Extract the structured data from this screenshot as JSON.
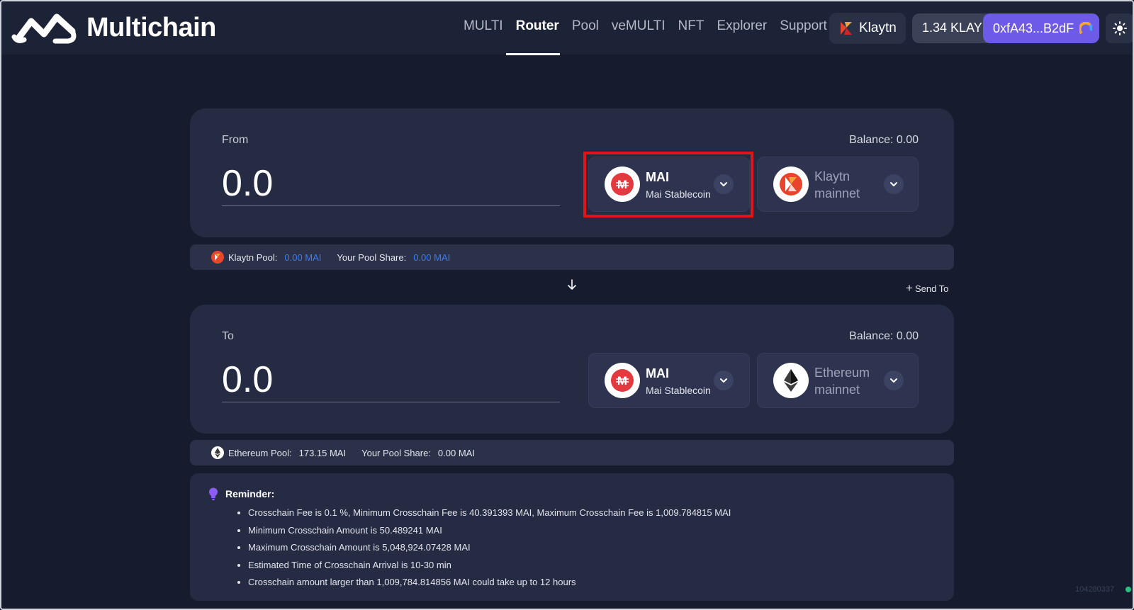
{
  "header": {
    "brand": "Multichain",
    "nav": [
      {
        "label": "MULTI",
        "active": false
      },
      {
        "label": "Router",
        "active": true
      },
      {
        "label": "Pool",
        "active": false
      },
      {
        "label": "veMULTI",
        "active": false
      },
      {
        "label": "NFT",
        "active": false
      },
      {
        "label": "Explorer",
        "active": false
      },
      {
        "label": "Support",
        "active": false
      }
    ],
    "chain_button": "Klaytn",
    "wallet_balance": "1.34 KLAY",
    "wallet_address": "0xfA43...B2dF"
  },
  "from": {
    "label": "From",
    "balance": "Balance: 0.00",
    "amount": "0.0",
    "token_symbol": "MAI",
    "token_name": "Mai Stablecoin",
    "chain_line1": "Klaytn",
    "chain_line2": "mainnet"
  },
  "from_pool": {
    "pool_label": "Klaytn Pool:",
    "pool_value": "0.00 MAI",
    "share_label": "Your Pool Share:",
    "share_value": "0.00 MAI"
  },
  "send_to": "Send To",
  "to": {
    "label": "To",
    "balance": "Balance: 0.00",
    "amount": "0.0",
    "token_symbol": "MAI",
    "token_name": "Mai Stablecoin",
    "chain_line1": "Ethereum",
    "chain_line2": "mainnet"
  },
  "to_pool": {
    "pool_label": "Ethereum Pool:",
    "pool_value": "173.15 MAI",
    "share_label": "Your Pool Share:",
    "share_value": "0.00 MAI"
  },
  "reminder": {
    "title": "Reminder:",
    "items": [
      "Crosschain Fee is 0.1 %, Minimum Crosschain Fee is 40.391393 MAI, Maximum Crosschain Fee is 1,009.784815 MAI",
      "Minimum Crosschain Amount is 50.489241 MAI",
      "Maximum Crosschain Amount is 5,048,924.07428 MAI",
      "Estimated Time of Crosschain Arrival is 10-30 min",
      "Crosschain amount larger than 1,009,784.814856 MAI could take up to 12 hours"
    ]
  },
  "version": "104280337",
  "colors": {
    "background": "#161c2e",
    "panel": "#252b42",
    "accent_purple": "#6d5be8",
    "link_blue": "#3f7cf3",
    "highlight_red": "#e0141c"
  }
}
